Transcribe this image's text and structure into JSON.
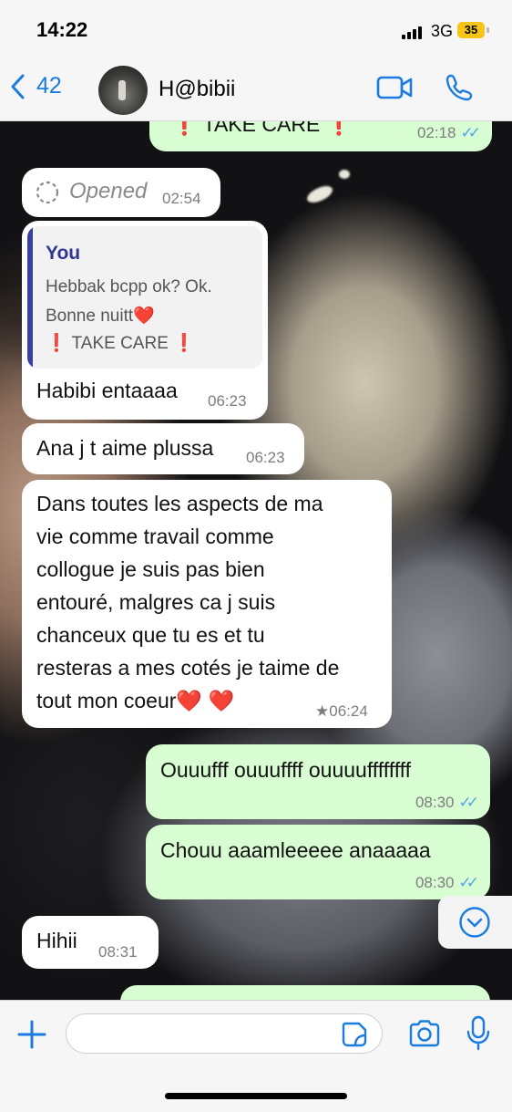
{
  "status_bar": {
    "time": "14:22",
    "network": "3G",
    "battery": "35"
  },
  "header": {
    "back_count": "42",
    "contact_name": "H@bibii"
  },
  "messages": {
    "top_out": {
      "text": "❗ TAKE CARE ❗",
      "time": "02:18"
    },
    "opened": {
      "text": "Opened",
      "time": "02:54"
    },
    "reply": {
      "quote_author": "You",
      "quote_line1": "Hebbak bcpp ok? Ok.",
      "quote_line2": "Bonne nuitt❤️",
      "quote_line3": "❗ TAKE CARE ❗",
      "text": "Habibi entaaaa",
      "time": "06:23"
    },
    "m2": {
      "text": "Ana j t aime plussa",
      "time": "06:23"
    },
    "m3": {
      "line1": "Dans toutes les aspects de ma",
      "line2": "vie comme travail comme",
      "line3": "collogue je suis pas bien",
      "line4": "entouré, malgres ca j suis",
      "line5": "chanceux que tu es et tu",
      "line6": "resteras a mes cotés je taime de",
      "line7": "tout mon coeur❤️ ❤️",
      "time": "06:24"
    },
    "m4": {
      "text": "Ouuufff ouuuffff ouuuuffffffff",
      "time": "08:30"
    },
    "m5": {
      "text": "Chouu aaamleeeee anaaaaa",
      "time": "08:30"
    },
    "m6": {
      "text": "Hihii",
      "time": "08:31"
    }
  },
  "input": {
    "value": "",
    "placeholder": ""
  },
  "colors": {
    "accent": "#1a7ce0",
    "outgoing_bubble": "#d9fdd3",
    "incoming_bubble": "#ffffff",
    "read_ticks": "#4fa6e8",
    "quote_bar": "#3a3fa0"
  }
}
